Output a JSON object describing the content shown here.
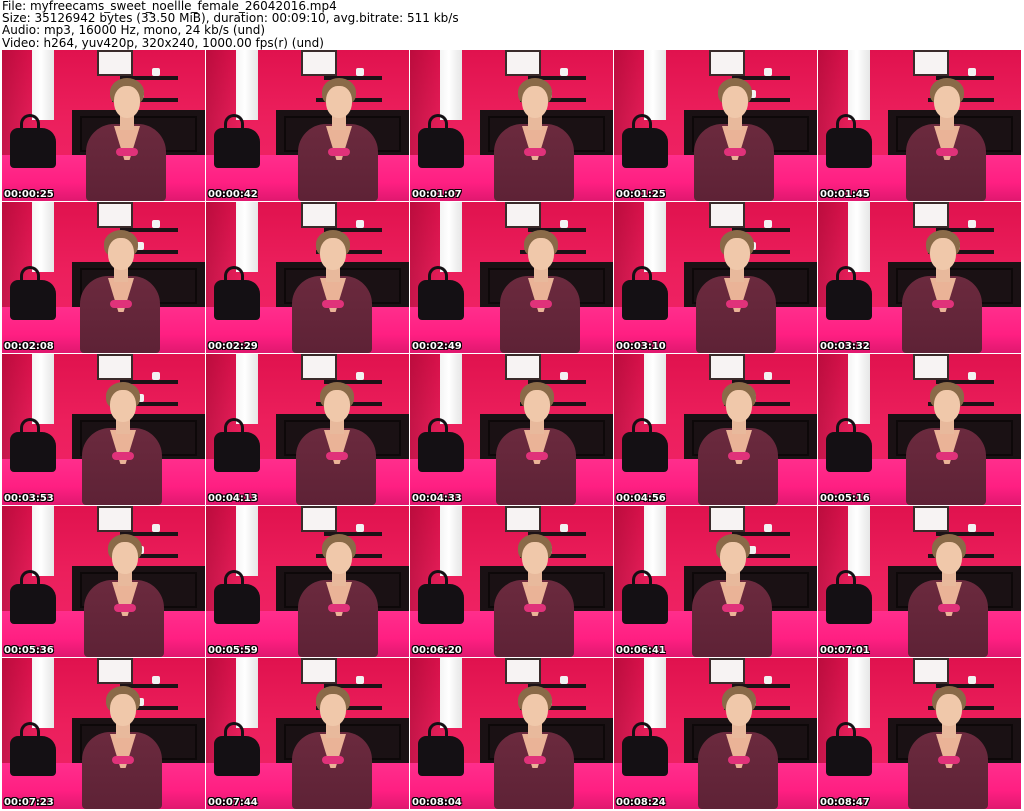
{
  "header": {
    "file_line": "File: myfreecams_sweet_noellle_female_26042016.mp4",
    "size_line": "Size: 35126942 bytes (33.50 MiB), duration: 00:09:10, avg.bitrate: 511 kb/s",
    "audio_line": "Audio: mp3, 16000 Hz, mono, 24 kb/s (und)",
    "video_line": "Video: h264, yuv420p, 320x240, 1000.00 fps(r) (und)"
  },
  "thumbnails": [
    {
      "timestamp": "00:00:25"
    },
    {
      "timestamp": "00:00:42"
    },
    {
      "timestamp": "00:01:07"
    },
    {
      "timestamp": "00:01:25"
    },
    {
      "timestamp": "00:01:45"
    },
    {
      "timestamp": "00:02:08"
    },
    {
      "timestamp": "00:02:29"
    },
    {
      "timestamp": "00:02:49"
    },
    {
      "timestamp": "00:03:10"
    },
    {
      "timestamp": "00:03:32"
    },
    {
      "timestamp": "00:03:53"
    },
    {
      "timestamp": "00:04:13"
    },
    {
      "timestamp": "00:04:33"
    },
    {
      "timestamp": "00:04:56"
    },
    {
      "timestamp": "00:05:16"
    },
    {
      "timestamp": "00:05:36"
    },
    {
      "timestamp": "00:05:59"
    },
    {
      "timestamp": "00:06:20"
    },
    {
      "timestamp": "00:06:41"
    },
    {
      "timestamp": "00:07:01"
    },
    {
      "timestamp": "00:07:23"
    },
    {
      "timestamp": "00:07:44"
    },
    {
      "timestamp": "00:08:04"
    },
    {
      "timestamp": "00:08:24"
    },
    {
      "timestamp": "00:08:47"
    }
  ],
  "colors": {
    "background": "#ffffff",
    "header_text": "#000000",
    "wall": "#ec1f5c",
    "bed": "#ff1f82",
    "cardigan": "#6b2a3e",
    "timestamp_text": "#ffffff"
  }
}
